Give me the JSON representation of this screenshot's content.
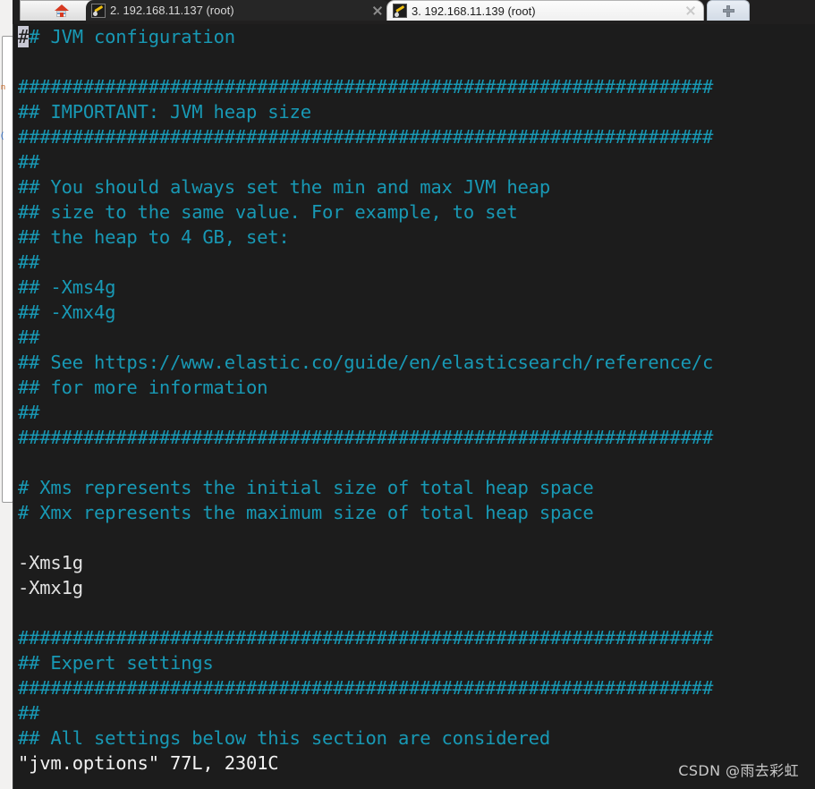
{
  "window": {
    "background_color": "#ffffff",
    "terminal_background": "#1c1c1c",
    "comment_color": "#1899b5",
    "text_color": "#e2e2e2"
  },
  "tabs": [
    {
      "id": "home",
      "label": "",
      "icon": "home-icon",
      "active": false,
      "closable": false
    },
    {
      "id": "tab-2",
      "label": "2. 192.168.11.137 (root)",
      "icon": "wrench-icon",
      "active": false,
      "closable": true
    },
    {
      "id": "tab-3",
      "label": "3. 192.168.11.139 (root)",
      "icon": "wrench-icon",
      "active": true,
      "closable": true
    }
  ],
  "new_tab": {
    "label": "",
    "icon": "plus-icon"
  },
  "terminal": {
    "editor": "vim",
    "filename": "jvm.options",
    "status_line": "\"jvm.options\" 77L, 2301C",
    "cursor_char": "#",
    "lines": [
      {
        "text": "## JVM configuration",
        "style": "comment",
        "cursor": true
      },
      {
        "text": "",
        "style": "blank"
      },
      {
        "text": "################################################################",
        "style": "comment"
      },
      {
        "text": "## IMPORTANT: JVM heap size",
        "style": "comment"
      },
      {
        "text": "################################################################",
        "style": "comment"
      },
      {
        "text": "##",
        "style": "comment"
      },
      {
        "text": "## You should always set the min and max JVM heap",
        "style": "comment"
      },
      {
        "text": "## size to the same value. For example, to set",
        "style": "comment"
      },
      {
        "text": "## the heap to 4 GB, set:",
        "style": "comment"
      },
      {
        "text": "##",
        "style": "comment"
      },
      {
        "text": "## -Xms4g",
        "style": "comment"
      },
      {
        "text": "## -Xmx4g",
        "style": "comment"
      },
      {
        "text": "##",
        "style": "comment"
      },
      {
        "text": "## See https://www.elastic.co/guide/en/elasticsearch/reference/c",
        "style": "comment"
      },
      {
        "text": "## for more information",
        "style": "comment"
      },
      {
        "text": "##",
        "style": "comment"
      },
      {
        "text": "################################################################",
        "style": "comment"
      },
      {
        "text": "",
        "style": "blank"
      },
      {
        "text": "# Xms represents the initial size of total heap space",
        "style": "comment"
      },
      {
        "text": "# Xmx represents the maximum size of total heap space",
        "style": "comment"
      },
      {
        "text": "",
        "style": "blank"
      },
      {
        "text": "-Xms1g",
        "style": "plain"
      },
      {
        "text": "-Xmx1g",
        "style": "plain"
      },
      {
        "text": "",
        "style": "blank"
      },
      {
        "text": "################################################################",
        "style": "comment"
      },
      {
        "text": "## Expert settings",
        "style": "comment"
      },
      {
        "text": "################################################################",
        "style": "comment"
      },
      {
        "text": "##",
        "style": "comment"
      },
      {
        "text": "## All settings below this section are considered",
        "style": "comment"
      },
      {
        "text": "\"jvm.options\" 77L, 2301C",
        "style": "status"
      }
    ]
  },
  "watermark": {
    "text": "CSDN @雨去彩虹"
  }
}
